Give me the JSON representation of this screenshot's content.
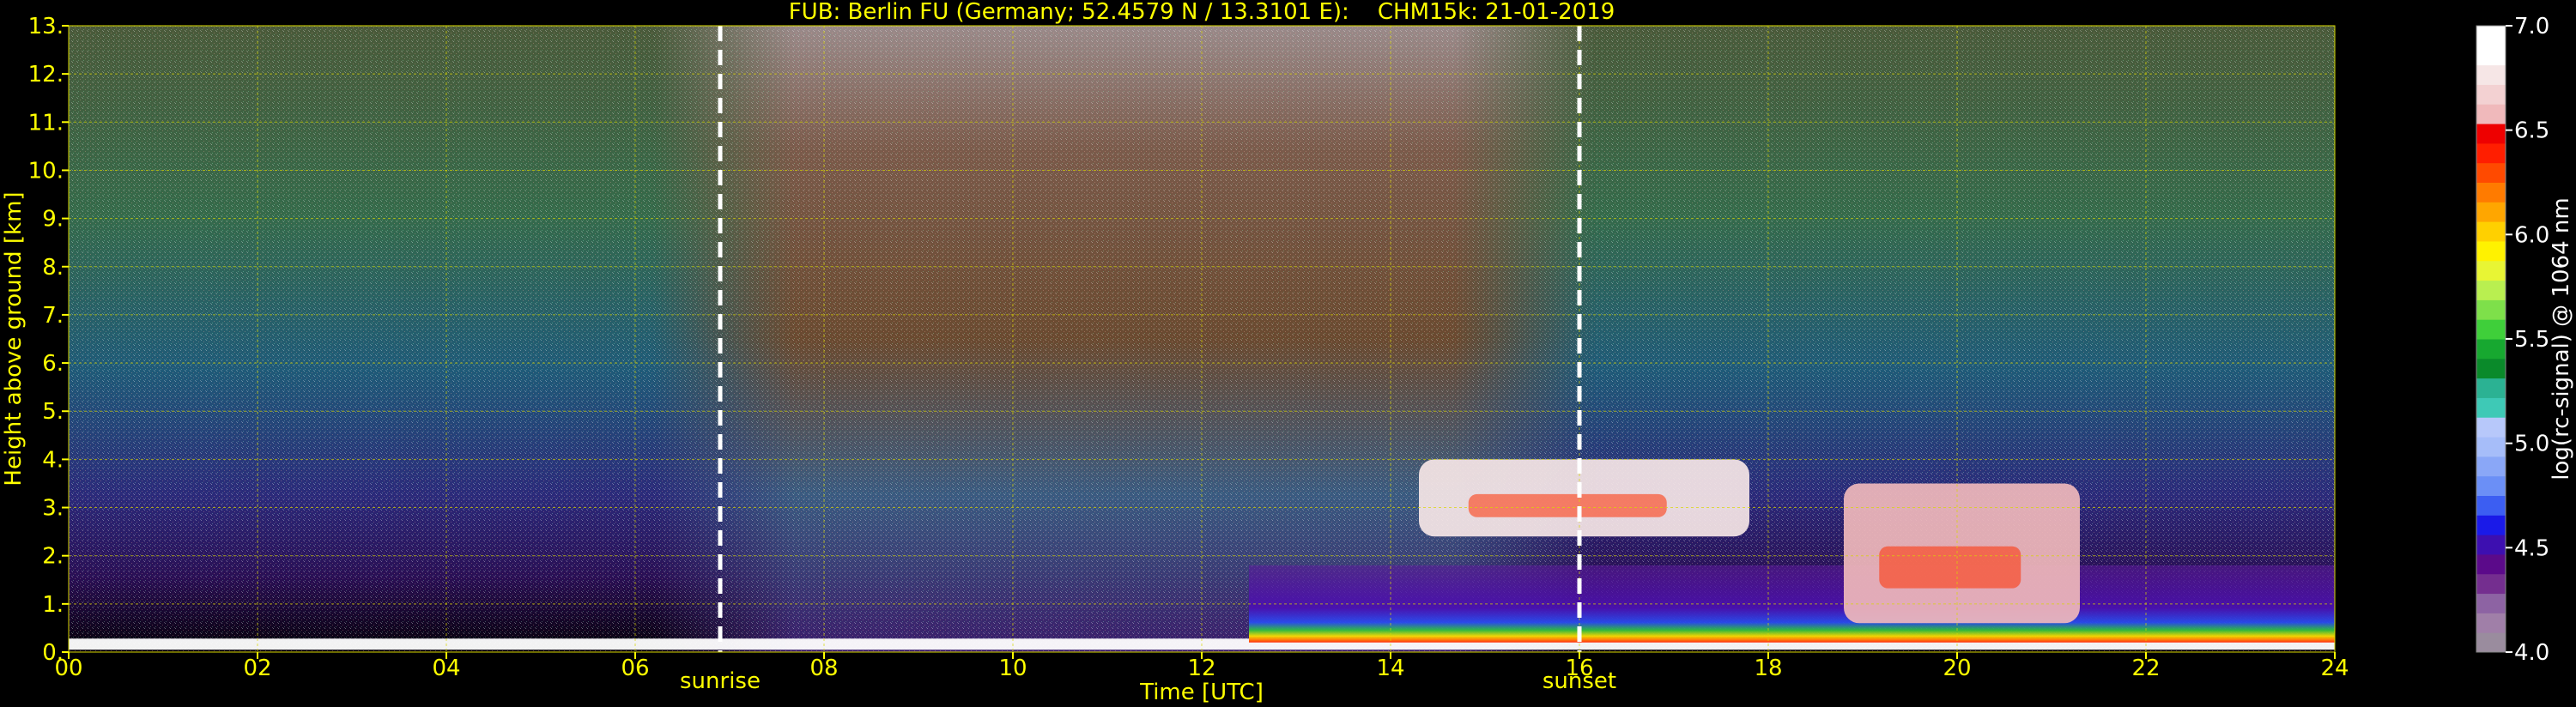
{
  "chart_data": {
    "type": "heatmap",
    "title": "FUB: Berlin FU (Germany; 52.4579 N / 13.3101 E):    CHM15k: 21-01-2019",
    "xlabel": "Time [UTC]",
    "ylabel": "Height above ground [km]",
    "xlim": [
      0,
      24
    ],
    "ylim": [
      0,
      13
    ],
    "x_ticks": [
      "00",
      "02",
      "04",
      "06",
      "08",
      "10",
      "12",
      "14",
      "16",
      "18",
      "20",
      "22",
      "24"
    ],
    "y_ticks": [
      "0.",
      "1.",
      "2.",
      "3.",
      "4.",
      "5.",
      "6.",
      "7.",
      "8.",
      "9.",
      "10.",
      "11.",
      "12.",
      "13."
    ],
    "grid": true,
    "markers": [
      {
        "label": "sunrise",
        "x": 6.9
      },
      {
        "label": "sunset",
        "x": 16.0
      }
    ],
    "colorbar": {
      "label": "log(rc-signal) @ 1064 nm",
      "range": [
        4.0,
        7.0
      ],
      "ticks": [
        "4.0",
        "4.5",
        "5.0",
        "5.5",
        "6.0",
        "6.5",
        "7.0"
      ],
      "colors": [
        "#9a8c9e",
        "#a07fa8",
        "#8d63a3",
        "#742e8f",
        "#5b0a8a",
        "#3d0fb0",
        "#1a1ae8",
        "#3c5ef2",
        "#6b8ff6",
        "#8aa7f7",
        "#a6bdf9",
        "#b7c8fa",
        "#3ec9b6",
        "#2bb293",
        "#0a8a2a",
        "#17a830",
        "#3fcf3a",
        "#7ee04a",
        "#b9ef50",
        "#e8f534",
        "#fff200",
        "#ffd000",
        "#ffa600",
        "#ff7b00",
        "#ff4a00",
        "#ff1e00",
        "#ee0000",
        "#f0b9bb",
        "#f3d1d2",
        "#f6e6e6",
        "#ffffff",
        "#ffffff"
      ]
    },
    "features": [
      {
        "name": "surface layer",
        "t_start": 0,
        "t_end": 24,
        "h_bottom": 0.05,
        "h_top": 0.28,
        "level": 7.0
      },
      {
        "name": "boundary layer",
        "t_start": 12.5,
        "t_end": 24,
        "h_bottom": 0.2,
        "h_top": 1.8,
        "level": 4.6
      },
      {
        "name": "cloud layer",
        "t_start": 14.3,
        "t_end": 17.8,
        "h_bottom": 2.4,
        "h_top": 4.0,
        "level": 6.8
      },
      {
        "name": "cloud layer",
        "t_start": 18.8,
        "t_end": 21.3,
        "h_bottom": 0.6,
        "h_top": 3.5,
        "level": 6.6
      }
    ]
  },
  "colors": {
    "text": "#ffff00",
    "background": "#000000",
    "grid": "#d8d800",
    "marker": "#ffffff",
    "colorbar_text": "#ffffff"
  }
}
